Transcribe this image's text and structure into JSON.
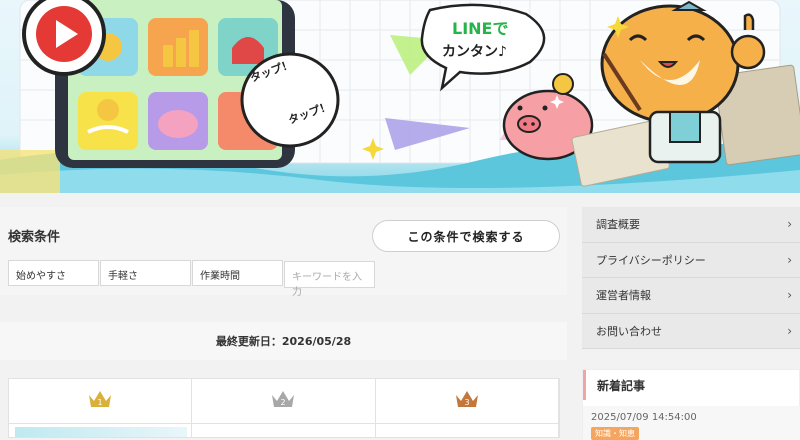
{
  "hero": {
    "bubble_line1": "LINEで",
    "bubble_line2": "カンタン♪",
    "tap_label_1": "タップ！",
    "tap_label_2": "タップ！"
  },
  "search": {
    "title": "検索条件",
    "submit_label": "この条件で検索する",
    "filters": [
      "始めやすさ",
      "手軽さ",
      "作業時間"
    ],
    "keyword_placeholder": "キーワードを入力"
  },
  "updated": {
    "text": "最終更新日：2026/05/28"
  },
  "ranking": {
    "ranks": [
      {
        "rank": "1",
        "color": "#d9b13a"
      },
      {
        "rank": "2",
        "color": "#a8a8a8"
      },
      {
        "rank": "3",
        "color": "#c4773a"
      }
    ]
  },
  "sidebar": {
    "menu": [
      {
        "label": "調査概要"
      },
      {
        "label": "プライバシーポリシー"
      },
      {
        "label": "運営者情報"
      },
      {
        "label": "お問い合わせ"
      }
    ],
    "news": {
      "title": "新着記事",
      "date": "2025/07/09 14:54:00",
      "tag": "知識・知恵"
    }
  },
  "colors": {
    "accent_pink": "#f1a4a4",
    "tag_orange": "#f6a55e",
    "teal": "#7fd3e4"
  }
}
